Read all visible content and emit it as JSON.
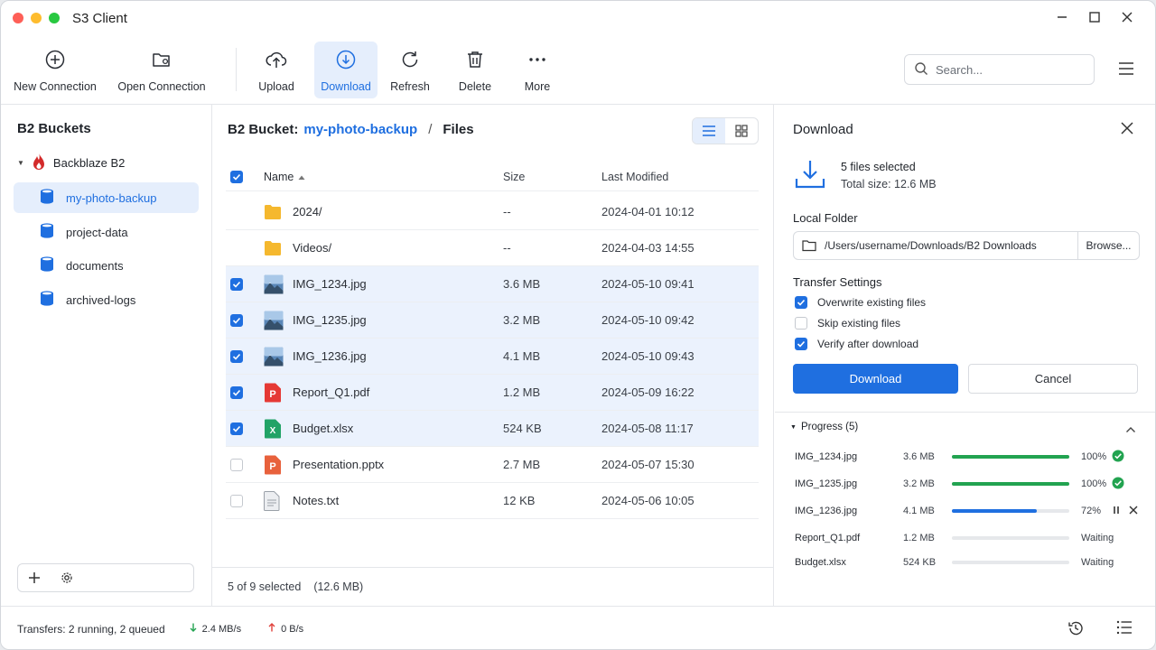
{
  "window": {
    "title": "S3 Client"
  },
  "toolbar": {
    "new_connection": "New Connection",
    "open_connection": "Open Connection",
    "upload": "Upload",
    "download": "Download",
    "refresh": "Refresh",
    "delete": "Delete",
    "more": "More",
    "search_placeholder": "Search..."
  },
  "sidebar": {
    "title": "B2 Buckets",
    "provider": "Backblaze B2",
    "buckets": [
      "my-photo-backup",
      "project-data",
      "documents",
      "archived-logs"
    ],
    "active_bucket": "my-photo-backup"
  },
  "main": {
    "breadcrumb": {
      "prefix": "B2 Bucket:",
      "bucket": "my-photo-backup",
      "separator": "/",
      "folder": "Files"
    },
    "columns": {
      "name": "Name",
      "size": "Size",
      "modified": "Last Modified"
    },
    "files": [
      {
        "name": "2024/",
        "size": "--",
        "modified": "2024-04-01 10:12",
        "type": "folder",
        "selected": false
      },
      {
        "name": "Videos/",
        "size": "--",
        "modified": "2024-04-03 14:55",
        "type": "folder",
        "selected": false
      },
      {
        "name": "IMG_1234.jpg",
        "size": "3.6 MB",
        "modified": "2024-05-10 09:41",
        "type": "image",
        "selected": true
      },
      {
        "name": "IMG_1235.jpg",
        "size": "3.2 MB",
        "modified": "2024-05-10 09:42",
        "type": "image",
        "selected": true
      },
      {
        "name": "IMG_1236.jpg",
        "size": "4.1 MB",
        "modified": "2024-05-10 09:43",
        "type": "image",
        "selected": true
      },
      {
        "name": "Report_Q1.pdf",
        "size": "1.2 MB",
        "modified": "2024-05-09 16:22",
        "type": "pdf",
        "selected": true
      },
      {
        "name": "Budget.xlsx",
        "size": "524 KB",
        "modified": "2024-05-08 11:17",
        "type": "xlsx",
        "selected": true
      },
      {
        "name": "Presentation.pptx",
        "size": "2.7 MB",
        "modified": "2024-05-07 15:30",
        "type": "pptx",
        "selected": false
      },
      {
        "name": "Notes.txt",
        "size": "12 KB",
        "modified": "2024-05-06 10:05",
        "type": "txt",
        "selected": false
      }
    ],
    "status": {
      "selected": "5 of 9 selected",
      "size": "(12.6 MB)"
    }
  },
  "panel": {
    "title": "Download",
    "files_selected": "5 files selected",
    "total_size": "Total size: 12.6 MB",
    "local_folder_label": "Local Folder",
    "local_folder_path": "/Users/username/Downloads/B2 Downloads",
    "browse": "Browse...",
    "transfer_settings_label": "Transfer Settings",
    "options": [
      {
        "label": "Overwrite existing files",
        "checked": true
      },
      {
        "label": "Skip existing files",
        "checked": false
      },
      {
        "label": "Verify after download",
        "checked": true
      }
    ],
    "download_button": "Download",
    "cancel_button": "Cancel",
    "progress_title": "Progress (5)",
    "progress": [
      {
        "name": "IMG_1234.jpg",
        "size": "3.6 MB",
        "fraction": 1.0,
        "status": "100%",
        "state": "done"
      },
      {
        "name": "IMG_1235.jpg",
        "size": "3.2 MB",
        "fraction": 1.0,
        "status": "100%",
        "state": "done"
      },
      {
        "name": "IMG_1236.jpg",
        "size": "4.1 MB",
        "fraction": 0.72,
        "status": "72%",
        "state": "running"
      },
      {
        "name": "Report_Q1.pdf",
        "size": "1.2 MB",
        "fraction": 0,
        "status": "Waiting",
        "state": "waiting"
      },
      {
        "name": "Budget.xlsx",
        "size": "524 KB",
        "fraction": 0,
        "status": "Waiting",
        "state": "waiting"
      }
    ]
  },
  "statusbar": {
    "transfers": "Transfers: 2 running, 2 queued",
    "down_rate": "2.4 MB/s",
    "up_rate": "0 B/s"
  },
  "colors": {
    "accent": "#1f6fe0",
    "success": "#22a350",
    "selection": "#ebf2fd"
  }
}
